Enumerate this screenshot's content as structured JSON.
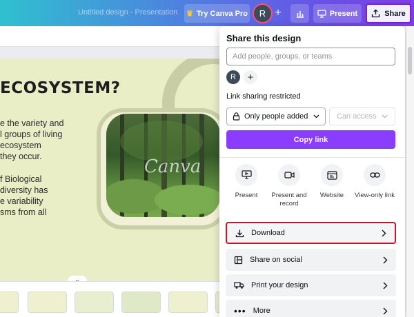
{
  "header": {
    "doc_title": "Untitled design - Presentation",
    "try_label": "Try Canva Pro",
    "avatar_letter": "R",
    "plus": "+",
    "present_label": "Present",
    "share_label": "Share",
    "accent": "#8b3dff"
  },
  "slide": {
    "title": "ECOSYSTEM?",
    "para1": [
      "e the variety and",
      "l groups of living",
      "ecosystem",
      "they occur."
    ],
    "para2": [
      "f Biological",
      "diversity has",
      "e variability",
      "sms from all"
    ],
    "watermark": "Canva"
  },
  "share_panel": {
    "title": "Share this design",
    "input_placeholder": "Add people, groups, or teams",
    "avatar_letter": "R",
    "add_member": "+",
    "link_sharing_label": "Link sharing restricted",
    "access_value": "Only people added",
    "permission_value": "Can access",
    "copy_link_label": "Copy link",
    "options": [
      {
        "label": "Present",
        "icon": "present-icon"
      },
      {
        "label": "Present and record",
        "icon": "record-icon"
      },
      {
        "label": "Website",
        "icon": "website-icon"
      },
      {
        "label": "View-only link",
        "icon": "link-icon"
      }
    ],
    "rows": [
      {
        "label": "Download",
        "icon": "download-icon",
        "highlighted": true
      },
      {
        "label": "Share on social",
        "icon": "social-icon"
      },
      {
        "label": "Print your design",
        "icon": "truck-icon"
      },
      {
        "label": "More",
        "icon": "more-icon"
      }
    ],
    "highlight_color": "#c3182b"
  }
}
